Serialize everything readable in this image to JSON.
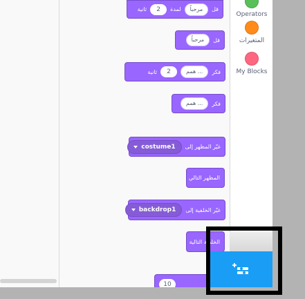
{
  "categories": [
    {
      "label": "Operators",
      "color": "#59c059"
    },
    {
      "label": "المتغيرات",
      "color": "#ff8c1a"
    },
    {
      "label": "My Blocks",
      "color": "#ff6680"
    }
  ],
  "blocks": {
    "say_for": {
      "prefix": "قل",
      "text": "مرحباً",
      "mid": "لمدة",
      "num": "2",
      "suffix": "ثانية"
    },
    "say": {
      "prefix": "قل",
      "text": "مرحباً"
    },
    "think_for": {
      "prefix": "فكر",
      "text": "همم ...",
      "num": "2",
      "suffix": "ثانية"
    },
    "think": {
      "prefix": "فكر",
      "text": "همم ..."
    },
    "switch_costume": {
      "label": "غيّر المظهر إلى",
      "value": "costume1"
    },
    "next_costume": {
      "label": "المظهر التالي"
    },
    "switch_backdrop": {
      "label": "غيّر الخلفية إلى",
      "value": "backdrop1"
    },
    "next_backdrop": {
      "label": "الخلفية التالية"
    },
    "change_size": {
      "num": "10"
    }
  },
  "add_extension_icon": "add-extension-icon",
  "colors": {
    "looks_block": "#9966ff",
    "highlight": "#000000",
    "extension_button": "#1a9ef5"
  }
}
